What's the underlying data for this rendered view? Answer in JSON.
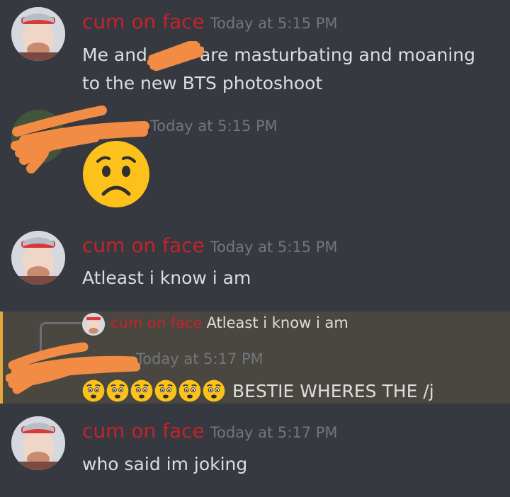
{
  "colors": {
    "background": "#36393f",
    "username": "#c4232b",
    "timestamp": "#72767d",
    "text": "#dcddde",
    "highlight_bg": "#4a4740",
    "highlight_bar": "#e2a93b",
    "redaction": "#f28c45"
  },
  "messages": [
    {
      "author": "cum on face",
      "time": "Today at 5:15 PM",
      "lines": [
        "Me and",
        "are masturbating and moaning",
        "to the new BTS photoshoot"
      ]
    },
    {
      "author": "",
      "time": "Today at 5:15 PM",
      "emoji": "worried-face"
    },
    {
      "author": "cum on face",
      "time": "Today at 5:15 PM",
      "lines": [
        "Atleast i know i am"
      ]
    },
    {
      "reply": {
        "author": "cum on face",
        "text": "Atleast i know i am"
      },
      "time": "Today at 5:17 PM",
      "text": "BESTIE WHERES THE /j",
      "emoji_count": 6
    },
    {
      "author": "cum on face",
      "time": "Today at 5:17 PM",
      "lines": [
        "who said im joking"
      ]
    }
  ]
}
